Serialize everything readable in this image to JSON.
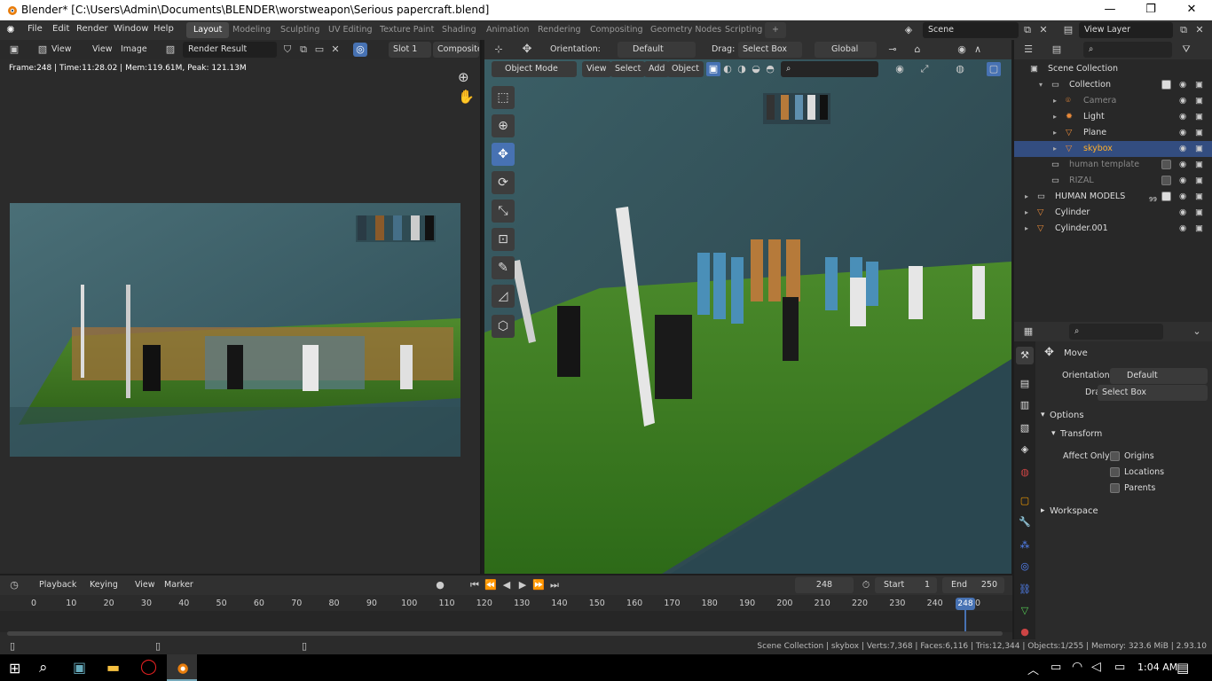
{
  "window": {
    "title": "Blender* [C:\\Users\\Admin\\Documents\\BLENDER\\worstweapon\\Serious papercraft.blend]",
    "minimize": "—",
    "maximize": "❐",
    "close": "✕"
  },
  "menu": [
    "File",
    "Edit",
    "Render",
    "Window",
    "Help"
  ],
  "workspaces": [
    "Layout",
    "Modeling",
    "Sculpting",
    "UV Editing",
    "Texture Paint",
    "Shading",
    "Animation",
    "Rendering",
    "Compositing",
    "Geometry Nodes",
    "Scripting"
  ],
  "active_workspace": "Layout",
  "add_tab": "+",
  "scene": {
    "scene_name": "Scene",
    "view_layer": "View Layer"
  },
  "image_editor": {
    "view": "View",
    "view2": "View",
    "image": "Image",
    "image_name": "Render Result",
    "slot": "Slot 1",
    "layer": "Composite",
    "info": "Frame:248 | Time:11:28.02 | Mem:119.61M, Peak: 121.13M"
  },
  "viewport": {
    "orientation_label": "Orientation:",
    "orientation": "Default",
    "drag_label": "Drag:",
    "drag": "Select Box",
    "transform": "Global",
    "mode": "Object Mode",
    "view": "View",
    "select": "Select",
    "add": "Add",
    "object": "Object"
  },
  "outliner": {
    "root": "Scene Collection",
    "items": [
      {
        "name": "Collection",
        "indent": 1,
        "icon": "collection-icon",
        "dim": false
      },
      {
        "name": "Camera",
        "indent": 2,
        "icon": "camera-icon",
        "dim": true
      },
      {
        "name": "Light",
        "indent": 2,
        "icon": "light-icon",
        "dim": false
      },
      {
        "name": "Plane",
        "indent": 2,
        "icon": "mesh-icon",
        "dim": false
      },
      {
        "name": "skybox",
        "indent": 2,
        "icon": "mesh-icon",
        "dim": false,
        "selected": true
      },
      {
        "name": "human template",
        "indent": 1,
        "icon": "collection-icon",
        "dim": true
      },
      {
        "name": "RIZAL",
        "indent": 1,
        "icon": "collection-icon",
        "dim": true
      },
      {
        "name": "HUMAN MODELS",
        "indent": 0,
        "icon": "collection-icon",
        "dim": false,
        "badge": "99"
      },
      {
        "name": "Cylinder",
        "indent": 0,
        "icon": "mesh-icon",
        "dim": false
      },
      {
        "name": "Cylinder.001",
        "indent": 0,
        "icon": "mesh-icon",
        "dim": false
      }
    ]
  },
  "properties": {
    "tool_name": "Move",
    "orientation_label": "Orientation",
    "orientation": "Default",
    "drag_label": "Drag:",
    "drag": "Select Box",
    "options": "Options",
    "transform": "Transform",
    "affect_only": "Affect Only",
    "origins": "Origins",
    "locations": "Locations",
    "parents": "Parents",
    "workspace": "Workspace"
  },
  "timeline": {
    "playback": "Playback",
    "keying": "Keying",
    "view": "View",
    "marker": "Marker",
    "current_frame": "248",
    "start_label": "Start",
    "start": "1",
    "end_label": "End",
    "end": "250",
    "ticks": [
      "0",
      "10",
      "20",
      "30",
      "40",
      "50",
      "60",
      "70",
      "80",
      "90",
      "100",
      "110",
      "120",
      "130",
      "140",
      "150",
      "160",
      "170",
      "180",
      "190",
      "200",
      "210",
      "220",
      "230",
      "240",
      "250"
    ],
    "playhead": "248"
  },
  "status_bar": "Scene Collection | skybox | Verts:7,368 | Faces:6,116 | Tris:12,344 | Objects:1/255 | Memory: 323.6 MiB | 2.93.10",
  "taskbar": {
    "time": "1:04 AM"
  },
  "colors": {
    "accent": "#4772b3",
    "header": "#303030",
    "panel": "#2a2a2a",
    "selected_row": "#334d80"
  }
}
